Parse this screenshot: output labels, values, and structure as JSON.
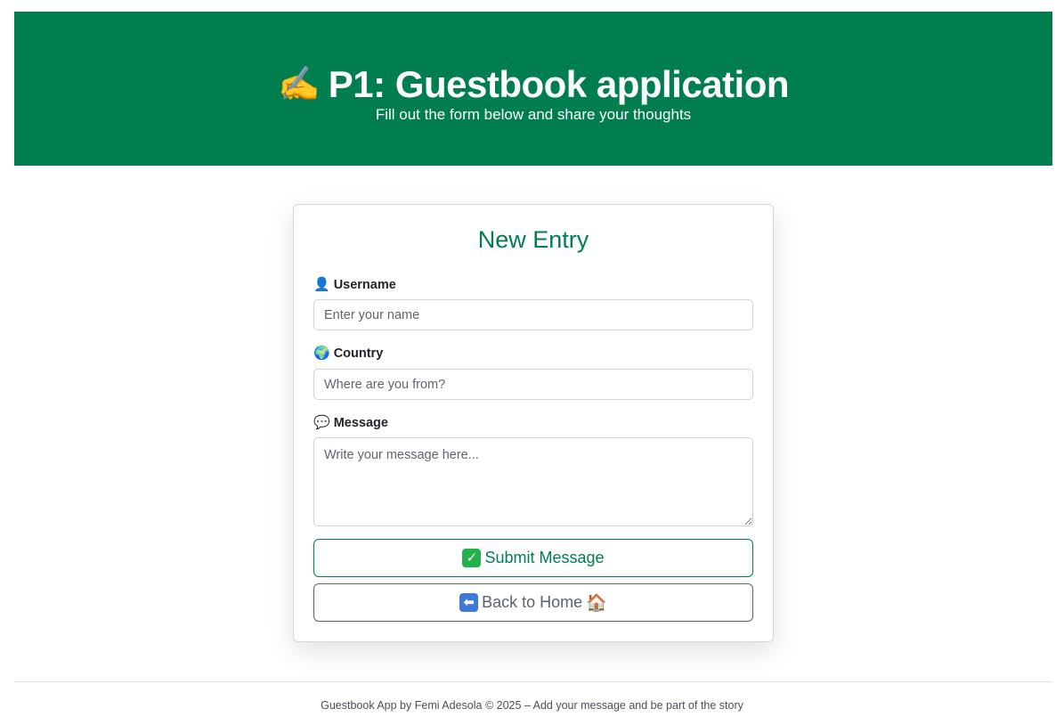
{
  "header": {
    "icon": "writing-hand-icon",
    "icon_glyph": "✍️",
    "title": "P1: Guestbook application",
    "subtitle": "Fill out the form below and share your thoughts",
    "background_color": "#017e4f"
  },
  "form": {
    "title": "New Entry",
    "fields": {
      "username": {
        "icon": "user-icon",
        "icon_glyph": "👤",
        "label": "Username",
        "value": "",
        "placeholder": "Enter your name"
      },
      "country": {
        "icon": "globe-icon",
        "icon_glyph": "🌍",
        "label": "Country",
        "value": "",
        "placeholder": "Where are you from?"
      },
      "message": {
        "icon": "speech-bubble-icon",
        "icon_glyph": "💬",
        "label": "Message",
        "value": "",
        "placeholder": "Write your message here..."
      }
    },
    "submit_button": {
      "icon": "check-mark-icon",
      "icon_glyph": "✓",
      "label": "Submit Message",
      "color": "#017e4f"
    },
    "back_button": {
      "icon": "left-arrow-icon",
      "icon_glyph": "⬅",
      "label": "Back to Home",
      "trailing_icon": "house-icon",
      "trailing_glyph": "🏠",
      "color": "#5c636a"
    }
  },
  "footer": {
    "text": "Guestbook App by Femi Adesola © 2025 – Add your message and be part of the story"
  }
}
